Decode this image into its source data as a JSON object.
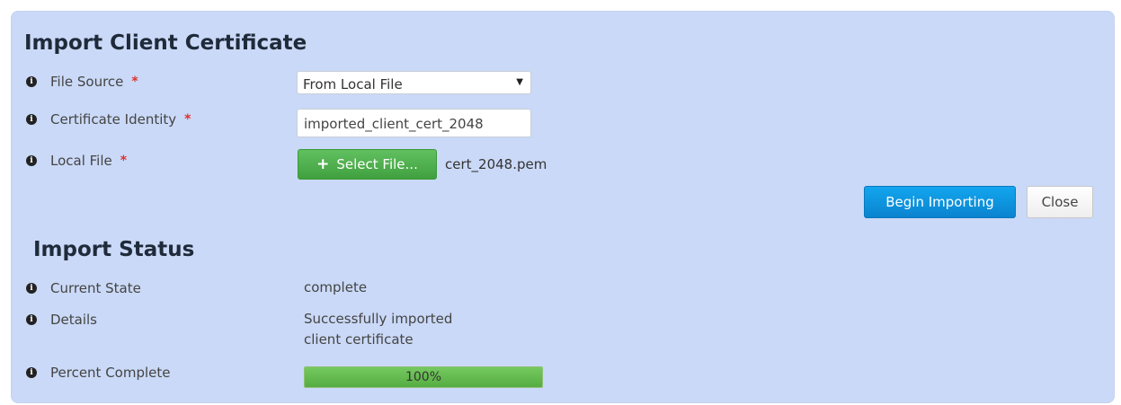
{
  "import_section": {
    "title": "Import Client Certificate",
    "file_source": {
      "label": "File Source",
      "required_mark": "*",
      "value": "From Local File",
      "caret": "▼"
    },
    "certificate_identity": {
      "label": "Certificate Identity",
      "required_mark": "*",
      "value": "imported_client_cert_2048"
    },
    "local_file": {
      "label": "Local File",
      "required_mark": "*",
      "button_label": "Select File...",
      "button_icon": "+",
      "file_name": "cert_2048.pem"
    },
    "info_icon_glyph": "i"
  },
  "actions": {
    "begin_label": "Begin Importing",
    "close_label": "Close"
  },
  "status_section": {
    "title": "Import Status",
    "current_state": {
      "label": "Current State",
      "value": "complete"
    },
    "details": {
      "label": "Details",
      "value_line1": "Successfully imported",
      "value_line2": "client certificate"
    },
    "percent_complete": {
      "label": "Percent Complete",
      "value": 100,
      "text": "100%"
    }
  },
  "colors": {
    "panel_background": "#cad9f7",
    "primary_button": "#0b8ed9",
    "success_button": "#4cae4c",
    "progress_fill": "#5cb947",
    "required": "#e03030"
  }
}
